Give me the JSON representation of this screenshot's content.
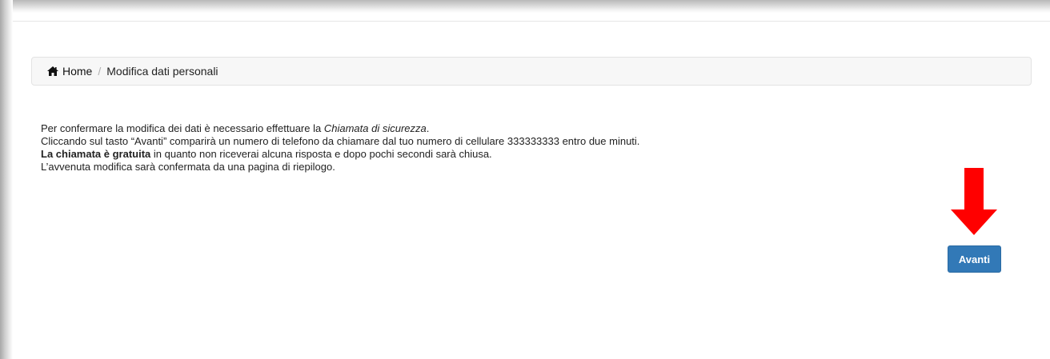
{
  "breadcrumb": {
    "home_icon": "home-icon",
    "home_label": "Home",
    "separator": "/",
    "current": "Modifica dati personali"
  },
  "message": {
    "line1_text": "Per confermare la modifica dei dati è necessario effettuare la ",
    "line1_emph": "Chiamata di sicurezza",
    "line1_end": ".",
    "line2": "Cliccando sul tasto “Avanti” comparirà un numero di telefono da chiamare dal tuo numero di cellulare 333333333 entro due minuti.",
    "line3_bold": "La chiamata è gratuita",
    "line3_rest": " in quanto non riceverai alcuna risposta e dopo pochi secondi sarà chiusa.",
    "line4": "L’avvenuta modifica sarà confermata da una pagina di riepilogo."
  },
  "actions": {
    "next_label": "Avanti"
  },
  "annotation": {
    "arrow_icon": "arrow-down-icon",
    "arrow_color": "#ff0000"
  },
  "colors": {
    "primary_button": "#3279b7",
    "breadcrumb_bg": "#f7f7f7"
  }
}
